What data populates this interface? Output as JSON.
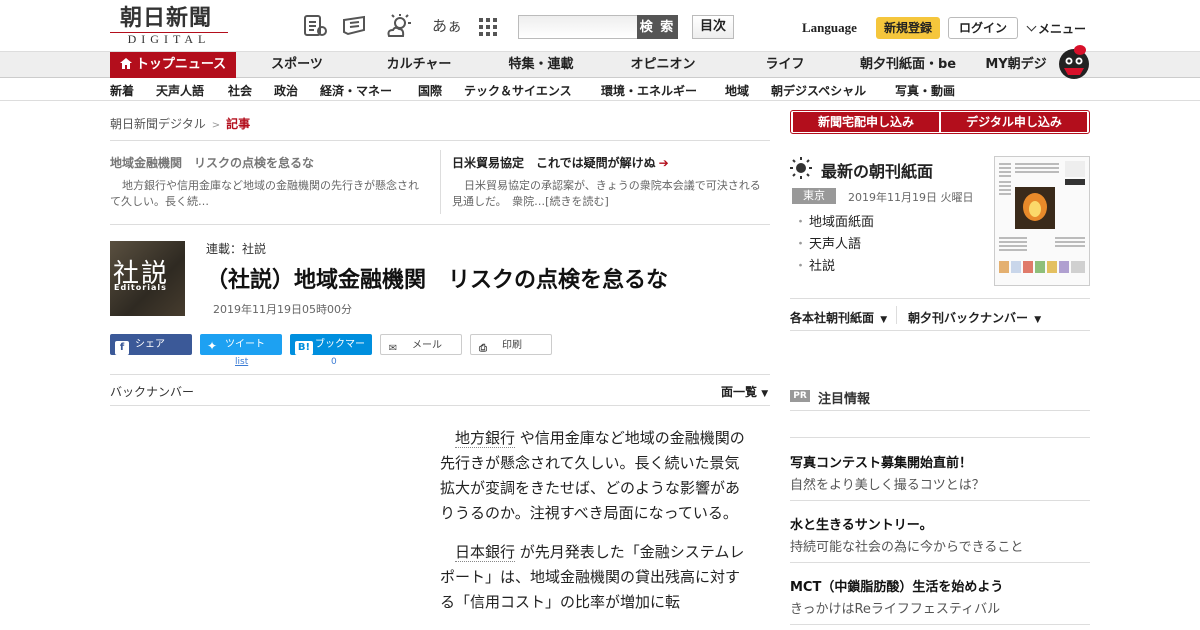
{
  "header": {
    "logo_main": "朝日新聞",
    "logo_sub": "DIGITAL",
    "font_size_icon": "あぁ",
    "search_placeholder": "",
    "search_button": "検 索",
    "toc_button": "目次",
    "language": "Language",
    "signup": "新規登録",
    "login": "ログイン",
    "menu": "メニュー"
  },
  "main_nav": [
    "トップニュース",
    "スポーツ",
    "カルチャー",
    "特集・連載",
    "オピニオン",
    "ライフ",
    "朝夕刊紙面・be",
    "MY朝デジ"
  ],
  "sub_nav": [
    "新着",
    "天声人語",
    "社会",
    "政治",
    "経済・マネー",
    "国際",
    "テック＆サイエンス",
    "環境・エネルギー",
    "地域",
    "朝デジスペシャル",
    "写真・動画"
  ],
  "breadcrumb": {
    "home": "朝日新聞デジタル",
    "current": "記事"
  },
  "related": [
    {
      "title": "地域金融機関　リスクの点検を怠るな",
      "text": "地方銀行や信用金庫など地域の金融機関の先行きが懸念されて久しい。長く続…"
    },
    {
      "title": "日米貿易協定　これでは疑問が解けぬ",
      "text": "日米貿易協定の承認案が、きょうの衆院本会議で可決される見通しだ。　衆院…[続きを読む]"
    }
  ],
  "article": {
    "series_thumb_main": "社説",
    "series_thumb_sub": "Editorials",
    "series": "連載：社説",
    "title": "（社説）地域金融機関　リスクの点検を怠るな",
    "date": "2019年11月19日05時00分",
    "share": {
      "facebook": "シェア",
      "twitter": "ツイート",
      "twitter_count": "list",
      "hatena": "ブックマーク",
      "hatena_count": "0",
      "mail": "メール",
      "print": "印刷"
    },
    "backnumber": "バックナンバー",
    "page_list": "面一覧",
    "para1_kw": "地方銀行",
    "para1_rest": " や信用金庫など地域の金融機関の先行きが懸念されて久しい。長く続いた景気拡大が変調をきたせば、どのような影響がありうるのか。注視すべき局面になっている。",
    "para2_kw": "日本銀行",
    "para2_rest": " が先月発表した「金融システムレポート」は、地域金融機関の貸出残高に対する「信用コスト」の比率が増加に転"
  },
  "sidebar": {
    "btn_delivery": "新聞宅配申し込み",
    "btn_digital": "デジタル申し込み",
    "paper_title": "最新の朝刊紙面",
    "region": "東京",
    "paper_date": "2019年11月19日 火曜日",
    "paper_links": [
      "地域面紙面",
      "天声人語",
      "社説"
    ],
    "dd_1": "各本社朝刊紙面",
    "dd_2": "朝夕刊バックナンバー",
    "pr_badge": "PR",
    "pr_label": "注目情報",
    "pr_items": [
      {
        "title": "写真コンテスト募集開始直前！",
        "sub": "自然をより美しく撮るコツとは？"
      },
      {
        "title": "水と生きるサントリー。",
        "sub": "持続可能な社会の為に今からできること"
      },
      {
        "title": "MCT（中鎖脂肪酸）生活を始めよう",
        "sub": "きっかけはReライフフェスティバル"
      }
    ]
  },
  "colors": {
    "brand_red": "#b30e1c",
    "signup_yellow": "#f5c63c",
    "facebook": "#3b5998",
    "twitter": "#1da1f2",
    "hatena": "#008fde"
  }
}
